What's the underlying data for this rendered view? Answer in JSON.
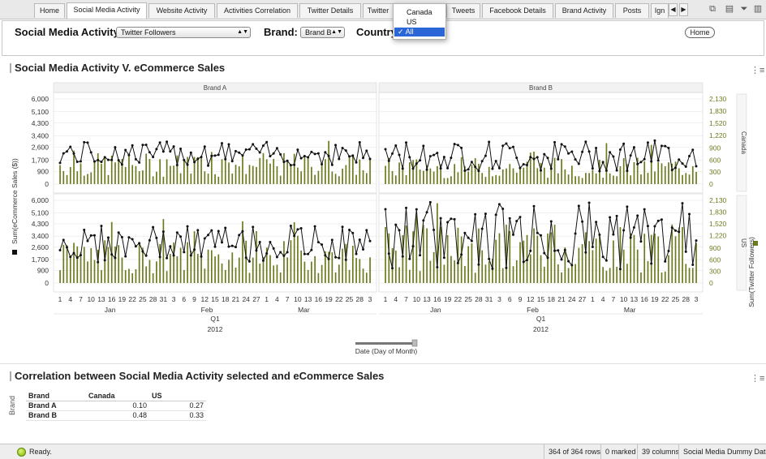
{
  "tabs": [
    {
      "label": "Home"
    },
    {
      "label": "Social Media Activity"
    },
    {
      "label": "Website Activity"
    },
    {
      "label": "Activities Correlation"
    },
    {
      "label": "Twitter Details"
    },
    {
      "label": "Twitter"
    },
    {
      "label": "Tweets"
    },
    {
      "label": "Facebook Details"
    },
    {
      "label": "Brand Activity"
    },
    {
      "label": "Posts"
    },
    {
      "label": "Ign"
    }
  ],
  "active_tab": "Social Media Activity",
  "filters": {
    "activity_label": "Social Media Activity:",
    "activity_value": "Twitter Followers",
    "brand_label": "Brand:",
    "brand_value": "Brand B",
    "country_label": "Country",
    "home_button": "Home"
  },
  "country_dropdown": {
    "options": [
      "Canada",
      "US",
      "All"
    ],
    "selected": "All",
    "check": "✓"
  },
  "section1": {
    "title": "Social Media Activity V. eCommerce Sales"
  },
  "section2": {
    "title": "Correlation between Social Media Activity selected and eCommerce Sales"
  },
  "chart_data": {
    "type": "bar+line",
    "title": "Social Media Activity V. eCommerce Sales",
    "panels_columns": [
      "Brand A",
      "Brand B"
    ],
    "panels_rows": [
      "Canada",
      "US"
    ],
    "left_axis_label": "Sum(eCommerce Sales ($))",
    "right_axis_label": "Sum(Twitter Followers)",
    "left_ticks": [
      0,
      900,
      1700,
      2600,
      3400,
      4300,
      5100,
      6000
    ],
    "left_tick_labels": [
      "0",
      "900",
      "1,700",
      "2,600",
      "3,400",
      "4,300",
      "5,100",
      "6,000"
    ],
    "right_ticks": [
      0,
      300,
      600,
      900,
      1220,
      1520,
      1830,
      2130
    ],
    "right_tick_labels": [
      "0",
      "300",
      "600",
      "900",
      "1,220",
      "1,520",
      "1,830",
      "2,130"
    ],
    "x_day_labels": [
      "1",
      "4",
      "7",
      "10",
      "13",
      "16",
      "19",
      "22",
      "25",
      "28",
      "31",
      "3",
      "6",
      "9",
      "12",
      "15",
      "18",
      "21",
      "24",
      "27",
      "1",
      "4",
      "7",
      "10",
      "13",
      "16",
      "19",
      "22",
      "25",
      "28",
      "3"
    ],
    "x_months": [
      "Jan",
      "Feb",
      "Mar"
    ],
    "x_quarter": "Q1",
    "x_year": "2012",
    "x_axis_title": "Date (Day of Month)",
    "series": [
      {
        "name": "Sum(eCommerce Sales ($))",
        "mark": "line"
      },
      {
        "name": "Sum(Twitter Followers)",
        "mark": "bar"
      }
    ],
    "panel_ranges": {
      "Brand A|Canada": {
        "line": [
          1300,
          3000
        ],
        "bar": [
          180,
          980
        ]
      },
      "Brand A|US": {
        "line": [
          1500,
          4200
        ],
        "bar": [
          250,
          1400
        ]
      },
      "Brand B|Canada": {
        "line": [
          900,
          3100
        ],
        "bar": [
          150,
          850
        ]
      },
      "Brand B|US": {
        "line": [
          1000,
          5900
        ],
        "bar": [
          250,
          1950
        ]
      }
    },
    "colors": {
      "line": "#111111",
      "bar": "#6e7a1e",
      "grid": "#e6e6e6",
      "right_axis": "#6e7a1e"
    }
  },
  "correlation_table": {
    "row_axis_label": "Brand",
    "headers": [
      "Brand",
      "Canada",
      "US"
    ],
    "rows": [
      {
        "brand": "Brand A",
        "canada": "0.10",
        "us": "0.27"
      },
      {
        "brand": "Brand B",
        "canada": "0.48",
        "us": "0.33"
      }
    ]
  },
  "statusbar": {
    "ready": "Ready.",
    "rows": "364 of 364 rows",
    "marked": "0 marked",
    "columns": "39 columns",
    "source": "Social Media Dummy Data"
  },
  "icons": [
    "chevron-left-icon",
    "chevron-right-icon",
    "bookmark-icon",
    "details-icon",
    "filter-icon",
    "panel-icon",
    "menu-icon"
  ]
}
